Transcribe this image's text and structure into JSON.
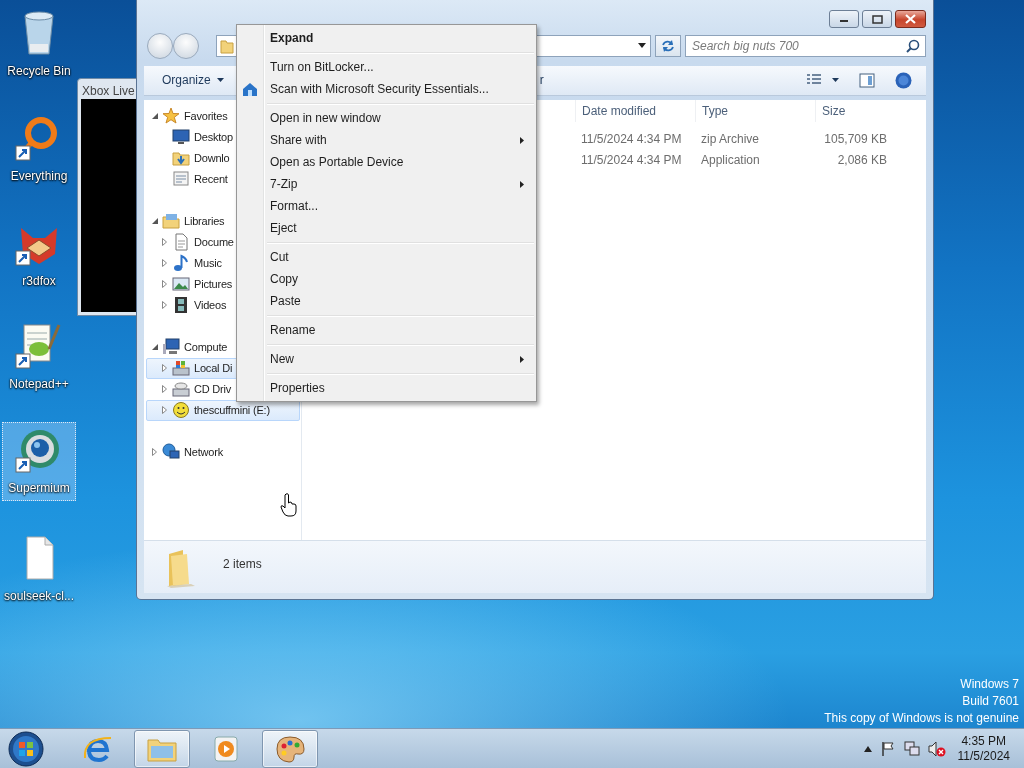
{
  "desktop_icons": [
    {
      "label": "Recycle Bin",
      "selected": false
    },
    {
      "label": "Everything",
      "selected": false
    },
    {
      "label": "r3dfox",
      "selected": false
    },
    {
      "label": "Notepad++",
      "selected": false
    },
    {
      "label": "Supermium",
      "selected": true
    },
    {
      "label": "soulseek-cl...",
      "selected": false
    }
  ],
  "background_window": {
    "title": "Xbox Live"
  },
  "explorer": {
    "search": {
      "placeholder": "Search big nuts 700"
    },
    "toolbar": {
      "organize": "Organize",
      "hidden_button": "r"
    },
    "nav_pane": [
      {
        "label": "Favorites",
        "expanded": true,
        "selected": false,
        "children": [
          {
            "label": "Desktop",
            "selected": false
          },
          {
            "label": "Downlo",
            "selected": false
          },
          {
            "label": "Recent",
            "selected": false
          }
        ]
      },
      {
        "label": "Libraries",
        "expanded": true,
        "selected": false,
        "children": [
          {
            "label": "Docume",
            "expanded": false,
            "selected": false
          },
          {
            "label": "Music",
            "expanded": false,
            "selected": false
          },
          {
            "label": "Pictures",
            "expanded": false,
            "selected": false
          },
          {
            "label": "Videos",
            "expanded": false,
            "selected": false
          }
        ]
      },
      {
        "label": "Compute",
        "expanded": true,
        "selected": false,
        "children": [
          {
            "label": "Local Di",
            "expanded": false,
            "selected": true
          },
          {
            "label": "CD Driv",
            "expanded": false,
            "selected": false
          },
          {
            "label": "thescuffmini (E:)",
            "expanded": false,
            "selected": true
          }
        ]
      },
      {
        "label": "Network",
        "expanded": false,
        "selected": false
      }
    ],
    "columns": [
      "Date modified",
      "Type",
      "Size"
    ],
    "rows": [
      {
        "date_modified": "11/5/2024 4:34 PM",
        "type": "zip Archive",
        "size": "105,709 KB"
      },
      {
        "date_modified": "11/5/2024 4:34 PM",
        "type": "Application",
        "size": "2,086 KB"
      }
    ],
    "details": {
      "item_count": "2 items"
    }
  },
  "context_menu": {
    "items": [
      {
        "kind": "item",
        "label": "Expand",
        "default": true,
        "submenu": false
      },
      {
        "kind": "separator"
      },
      {
        "kind": "item",
        "label": "Turn on BitLocker...",
        "default": false,
        "submenu": false
      },
      {
        "kind": "item",
        "label": "Scan with Microsoft Security Essentials...",
        "default": false,
        "submenu": false
      },
      {
        "kind": "separator"
      },
      {
        "kind": "item",
        "label": "Open in new window",
        "default": false,
        "submenu": false
      },
      {
        "kind": "item",
        "label": "Share with",
        "default": false,
        "submenu": true
      },
      {
        "kind": "item",
        "label": "Open as Portable Device",
        "default": false,
        "submenu": false
      },
      {
        "kind": "item",
        "label": "7-Zip",
        "default": false,
        "submenu": true
      },
      {
        "kind": "item",
        "label": "Format...",
        "default": false,
        "submenu": false
      },
      {
        "kind": "item",
        "label": "Eject",
        "default": false,
        "submenu": false
      },
      {
        "kind": "separator"
      },
      {
        "kind": "item",
        "label": "Cut",
        "default": false,
        "submenu": false
      },
      {
        "kind": "item",
        "label": "Copy",
        "default": false,
        "submenu": false
      },
      {
        "kind": "item",
        "label": "Paste",
        "default": false,
        "submenu": false
      },
      {
        "kind": "separator"
      },
      {
        "kind": "item",
        "label": "Rename",
        "default": false,
        "submenu": false
      },
      {
        "kind": "separator"
      },
      {
        "kind": "item",
        "label": "New",
        "default": false,
        "submenu": true
      },
      {
        "kind": "separator"
      },
      {
        "kind": "item",
        "label": "Properties",
        "default": false,
        "submenu": false
      }
    ]
  },
  "genuine_notice": [
    "Windows 7",
    "Build 7601",
    "This copy of Windows is not genuine"
  ],
  "taskbar": {
    "apps": [
      {
        "active": false
      },
      {
        "active": true
      },
      {
        "active": false
      },
      {
        "active": true
      }
    ],
    "clock": {
      "time": "4:35 PM",
      "date": "11/5/2024"
    }
  }
}
